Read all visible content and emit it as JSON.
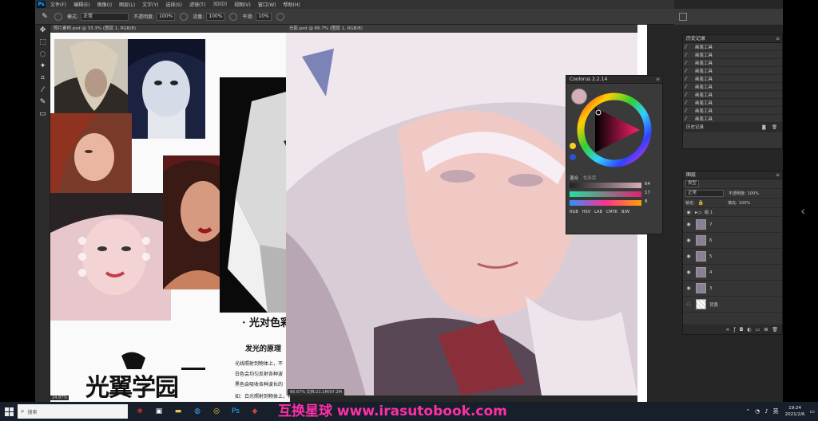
{
  "photoshop": {
    "menu": [
      "文件(F)",
      "编辑(E)",
      "图像(I)",
      "图层(L)",
      "文字(Y)",
      "选择(S)",
      "滤镜(T)",
      "3D(D)",
      "视图(V)",
      "窗口(W)",
      "帮助(H)"
    ],
    "options": {
      "brush_size": "",
      "mode_label": "模式:",
      "mode_value": "正常",
      "opacity_label": "不透明度:",
      "opacity_value": "100%",
      "flow_label": "流量:",
      "flow_value": "100%",
      "smoothing_label": "平滑:",
      "smoothing_value": "10%"
    },
    "doc_left_tab": "照片素材.psd @ 33.3% (图层 1, RGB/8)",
    "doc_right_tab": "光影.psd @ 66.7% (图层 1, RGB/8)",
    "doc_left_zoom": "24.87%",
    "doc_right_zoom": "66.67%",
    "doc_right_status": "文档:21.1M/97.2M"
  },
  "textbook": {
    "heading": "· 光对色彩",
    "subheading": "发光的原理",
    "lines": [
      "光线照射到物体上，不",
      "白色会均匀反射各种波",
      "黑色会吸收各种波长的",
      "如：白光照射到物体上，物体表面会选择性吸收一部分光波，反射另一部分光波"
    ]
  },
  "logo_text": "光翼学园",
  "coolorus": {
    "title": "Coolorus 2.2.14",
    "tabs": [
      "混合",
      "色彩库"
    ],
    "slider_values": [
      "64",
      "17",
      "8"
    ],
    "bottom_tabs": [
      "RGB",
      "HSV",
      "LAB",
      "CMYK",
      "B/W"
    ]
  },
  "history": {
    "title": "历史记录",
    "items": [
      "画笔工具",
      "画笔工具",
      "画笔工具",
      "画笔工具",
      "画笔工具",
      "画笔工具",
      "画笔工具",
      "画笔工具",
      "画笔工具",
      "画笔工具"
    ],
    "footer": "历史记录"
  },
  "layers": {
    "title": "图层",
    "kind": "类型",
    "blend": "正常",
    "opacity_label": "不透明度:",
    "opacity": "100%",
    "lock_label": "锁定:",
    "fill_label": "填充:",
    "fill": "100%",
    "items": [
      "组 1",
      "7",
      "6",
      "5",
      "4",
      "3",
      "背景"
    ]
  },
  "taskbar": {
    "search_placeholder": "搜索",
    "time": "19:24",
    "date": "2021/2/6"
  },
  "watermark": "互换星球 www.irasutobook.com"
}
